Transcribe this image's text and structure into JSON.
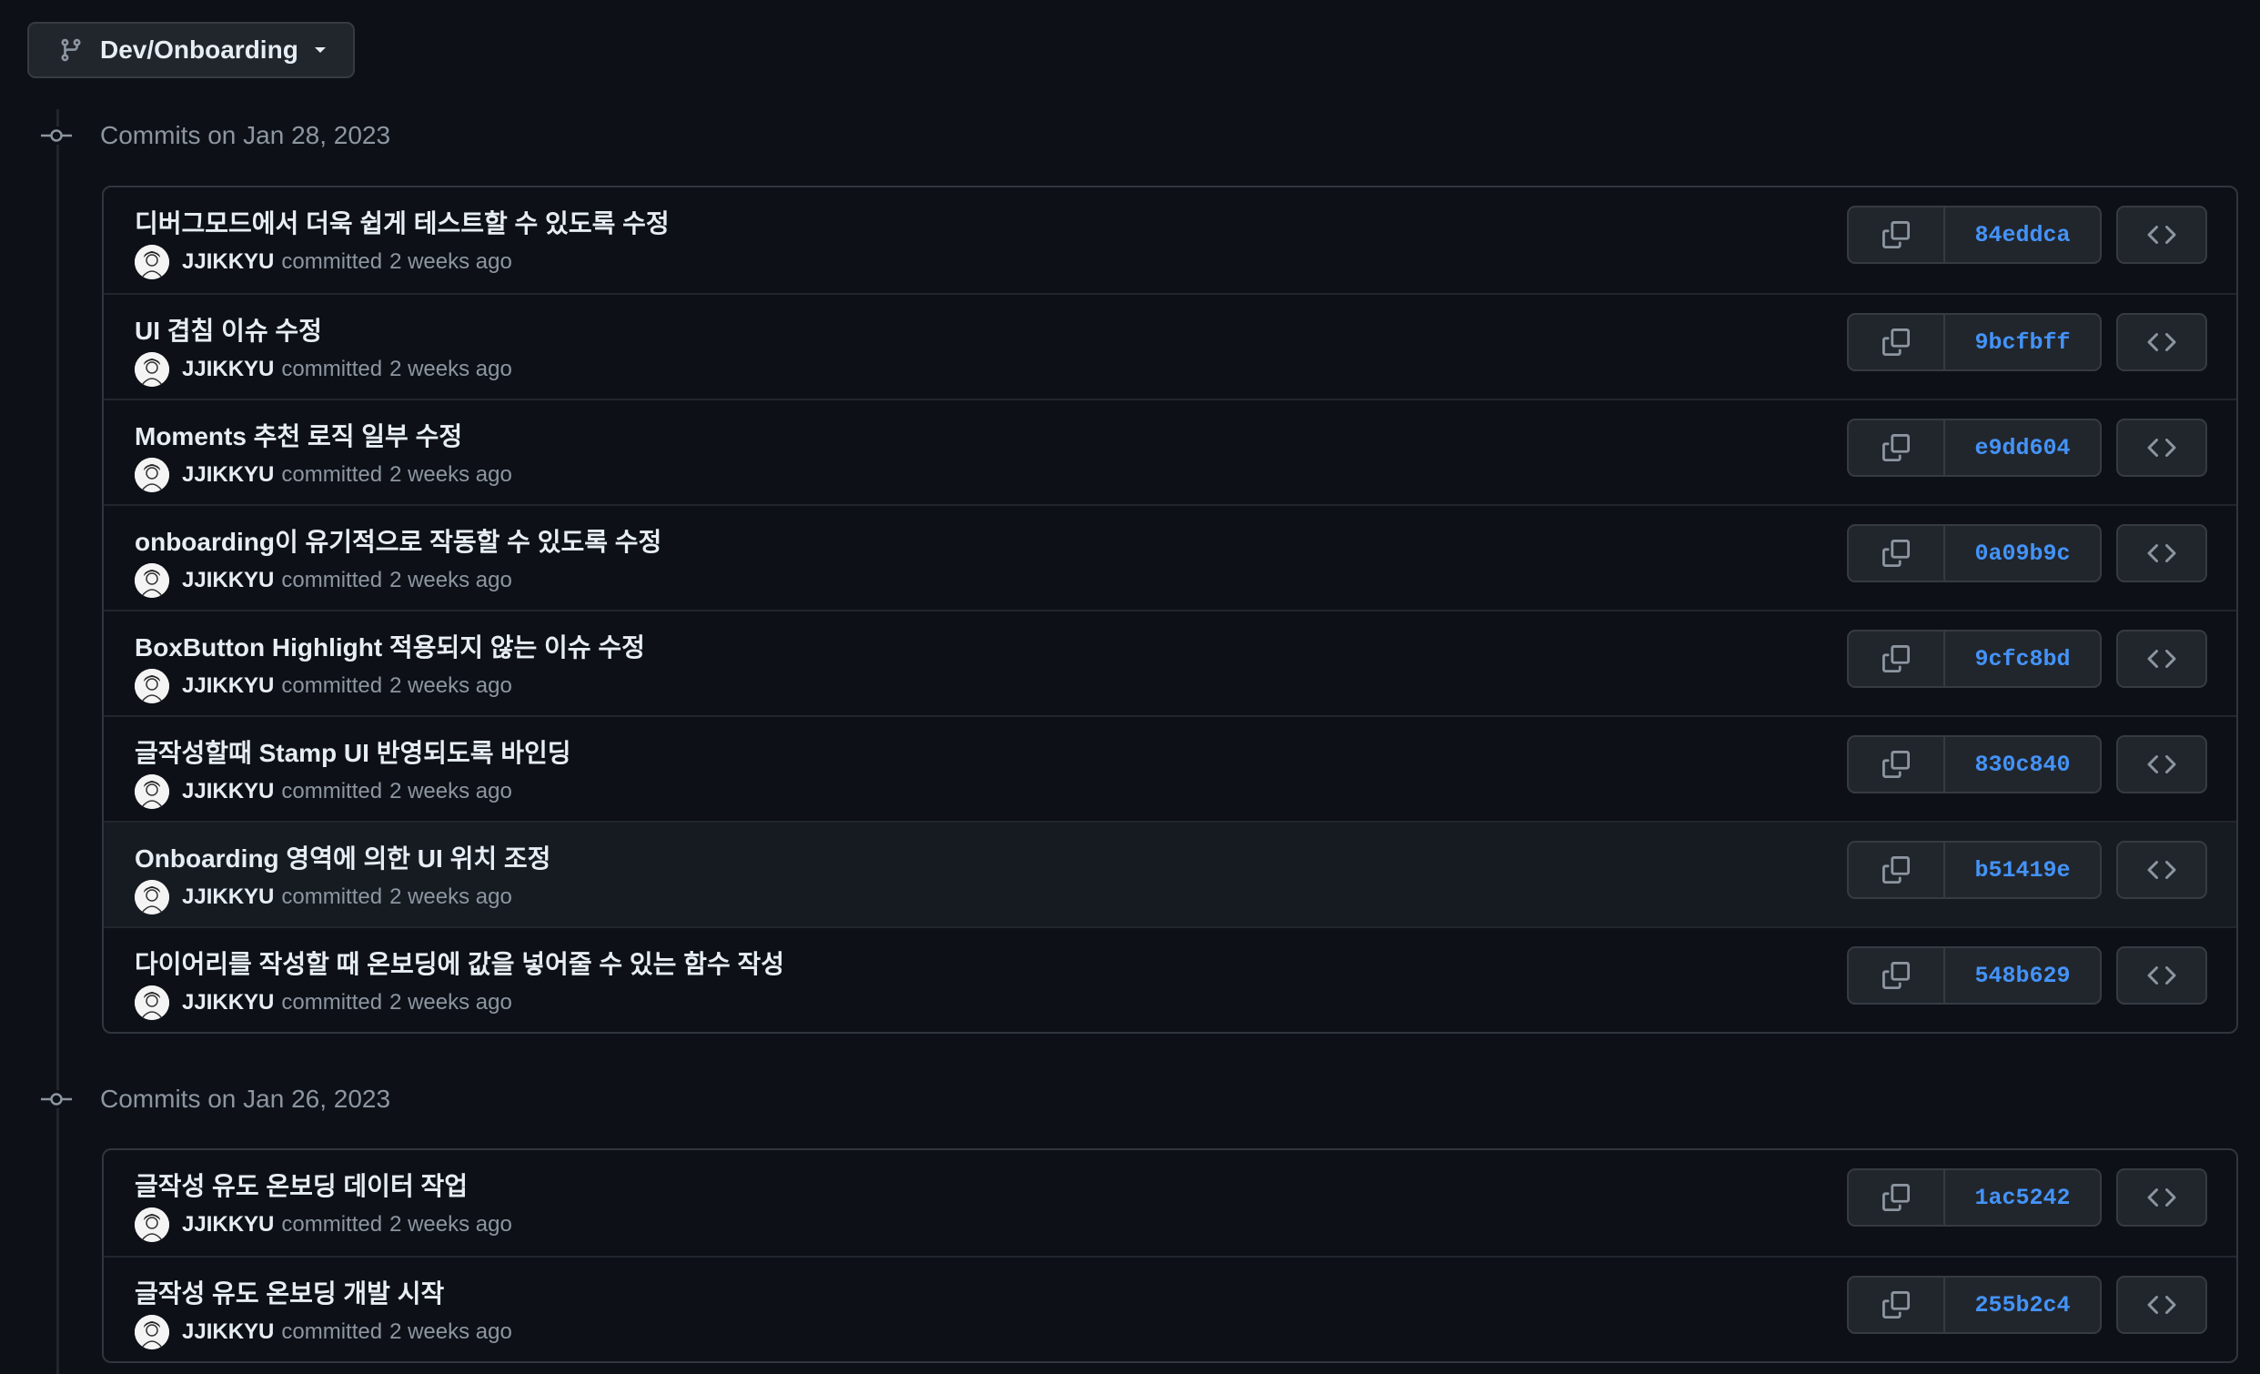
{
  "branch": {
    "label": "Dev/Onboarding",
    "icon": "git-branch-icon"
  },
  "colors": {
    "background": "#0d1117",
    "sha_link": "#4493f8",
    "muted_text": "#8d96a0"
  },
  "groups": [
    {
      "title": "Commits on Jan 28, 2023",
      "commits": [
        {
          "message": "디버그모드에서 더욱 쉽게 테스트할 수 있도록 수정",
          "author": "JJIKKYU",
          "verb": "committed",
          "time": "2 weeks ago",
          "sha": "84eddca"
        },
        {
          "message": "UI 겹침 이슈 수정",
          "author": "JJIKKYU",
          "verb": "committed",
          "time": "2 weeks ago",
          "sha": "9bcfbff"
        },
        {
          "message": "Moments 추천 로직 일부 수정",
          "author": "JJIKKYU",
          "verb": "committed",
          "time": "2 weeks ago",
          "sha": "e9dd604"
        },
        {
          "message": "onboarding이 유기적으로 작동할 수 있도록 수정",
          "author": "JJIKKYU",
          "verb": "committed",
          "time": "2 weeks ago",
          "sha": "0a09b9c"
        },
        {
          "message": "BoxButton Highlight 적용되지 않는 이슈 수정",
          "author": "JJIKKYU",
          "verb": "committed",
          "time": "2 weeks ago",
          "sha": "9cfc8bd"
        },
        {
          "message": "글작성할때 Stamp UI 반영되도록 바인딩",
          "author": "JJIKKYU",
          "verb": "committed",
          "time": "2 weeks ago",
          "sha": "830c840"
        },
        {
          "message": "Onboarding 영역에 의한 UI 위치 조정",
          "author": "JJIKKYU",
          "verb": "committed",
          "time": "2 weeks ago",
          "sha": "b51419e"
        },
        {
          "message": "다이어리를 작성할 때 온보딩에 값을 넣어줄 수 있는 함수 작성",
          "author": "JJIKKYU",
          "verb": "committed",
          "time": "2 weeks ago",
          "sha": "548b629"
        }
      ]
    },
    {
      "title": "Commits on Jan 26, 2023",
      "commits": [
        {
          "message": "글작성 유도 온보딩 데이터 작업",
          "author": "JJIKKYU",
          "verb": "committed",
          "time": "2 weeks ago",
          "sha": "1ac5242"
        },
        {
          "message": "글작성 유도 온보딩 개발 시작",
          "author": "JJIKKYU",
          "verb": "committed",
          "time": "2 weeks ago",
          "sha": "255b2c4"
        }
      ]
    }
  ]
}
